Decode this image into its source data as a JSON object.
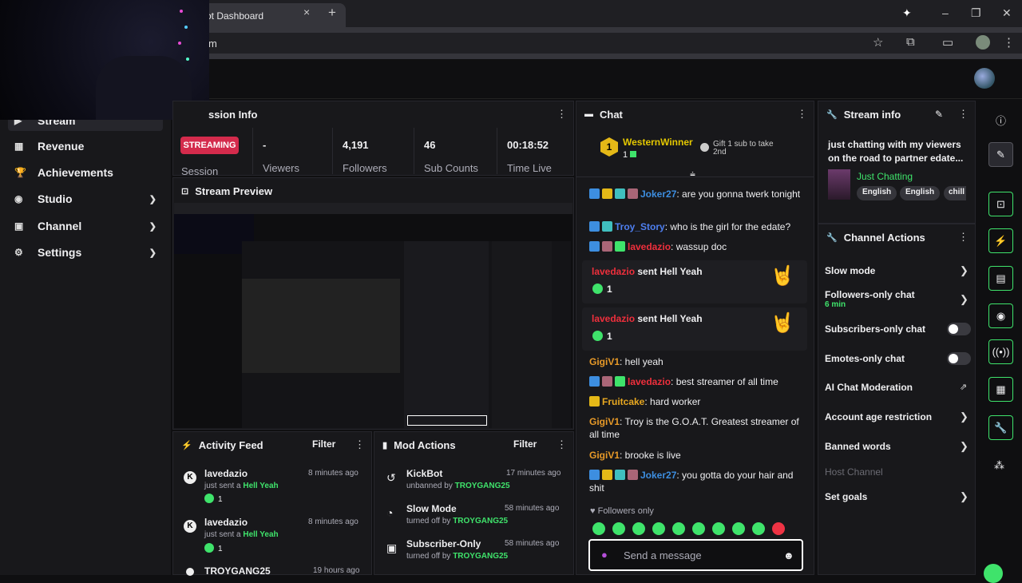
{
  "browser": {
    "tab_title": "ot Dashboard",
    "url": "m",
    "tab_close": "×",
    "new_tab": "+",
    "min": "–",
    "max": "❐",
    "close": "✕"
  },
  "sidebar": {
    "items": [
      {
        "label": "Stream",
        "icon": "▶"
      },
      {
        "label": "Revenue",
        "icon": "▦"
      },
      {
        "label": "Achievements",
        "icon": "🏆"
      },
      {
        "label": "Studio",
        "icon": "◉"
      },
      {
        "label": "Channel",
        "icon": "▣"
      },
      {
        "label": "Settings",
        "icon": "⚙"
      }
    ]
  },
  "session": {
    "title": "ssion Info",
    "badge": "STREAMING",
    "session_label": "Session",
    "stats": [
      {
        "value": "-",
        "label": "Viewers"
      },
      {
        "value": "4,191",
        "label": "Followers"
      },
      {
        "value": "46",
        "label": "Sub Counts"
      },
      {
        "value": "00:18:52",
        "label": "Time Live"
      }
    ]
  },
  "preview": {
    "title": "Stream Preview"
  },
  "activity": {
    "title": "Activity Feed",
    "filter": "Filter",
    "items": [
      {
        "name": "lavedazio",
        "text": "just sent a ",
        "gift": "Hell Yeah",
        "count": "1",
        "time": "8 minutes ago"
      },
      {
        "name": "lavedazio",
        "text": "just sent a ",
        "gift": "Hell Yeah",
        "count": "1",
        "time": "8 minutes ago"
      },
      {
        "name": "TROYGANG25",
        "time": "19 hours ago"
      }
    ]
  },
  "mod": {
    "title": "Mod Actions",
    "filter": "Filter",
    "items": [
      {
        "name": "KickBot",
        "action": "unbanned by ",
        "by": "TROYGANG25",
        "time": "17 minutes ago"
      },
      {
        "name": "Slow Mode",
        "action": "turned off by ",
        "by": "TROYGANG25",
        "time": "58 minutes ago"
      },
      {
        "name": "Subscriber-Only",
        "action": "turned off by ",
        "by": "TROYGANG25",
        "time": "58 minutes ago"
      }
    ]
  },
  "chat": {
    "title": "Chat",
    "pinned": {
      "rank": "1",
      "name": "WesternWinner",
      "count": "1",
      "gift_text": "Gift 1 sub to take 2nd"
    },
    "m1": {
      "user": "Joker27",
      "text": ": are you gonna twerk tonight"
    },
    "m2": {
      "user": "Troy_Story",
      "text": ": who is the girl for the edate?"
    },
    "m3": {
      "user": "lavedazio",
      "text": ": wassup doc"
    },
    "a1": {
      "user": "lavedazio",
      "text": " sent Hell Yeah",
      "count": "1"
    },
    "a2": {
      "user": "lavedazio",
      "text": " sent Hell Yeah",
      "count": "1"
    },
    "m4": {
      "user": "GigiV1",
      "text": ": hell yeah"
    },
    "m5": {
      "user": "lavedazio",
      "text": ": best streamer of all time"
    },
    "m6": {
      "user": "Fruitcake",
      "text": ": hard worker"
    },
    "m7": {
      "user": "GigiV1",
      "text": ": Troy is the G.O.A.T. Greatest streamer of all time"
    },
    "m8": {
      "user": "GigiV1",
      "text": ": brooke is live"
    },
    "m9": {
      "user": "Joker27",
      "text": ": you gotta do your hair and shit"
    },
    "followers_only": "Followers only",
    "placeholder": "Send a message"
  },
  "stream_info": {
    "title": "Stream info",
    "stream_title": "just chatting with my viewers on the road to partner edate...",
    "category": "Just Chatting",
    "tags": [
      "English",
      "English",
      "chill"
    ]
  },
  "channel_actions": {
    "title": "Channel Actions",
    "slow": "Slow mode",
    "followers": "Followers-only chat",
    "followers_time": "6 min",
    "subs": "Subscribers-only chat",
    "emotes": "Emotes-only chat",
    "ai": "AI Chat Moderation",
    "age": "Account age restriction",
    "banned": "Banned words",
    "host": "Host Channel",
    "goals": "Set goals"
  },
  "colors": {
    "accent": "#3fe36b",
    "streaming": "#d42b4c"
  }
}
